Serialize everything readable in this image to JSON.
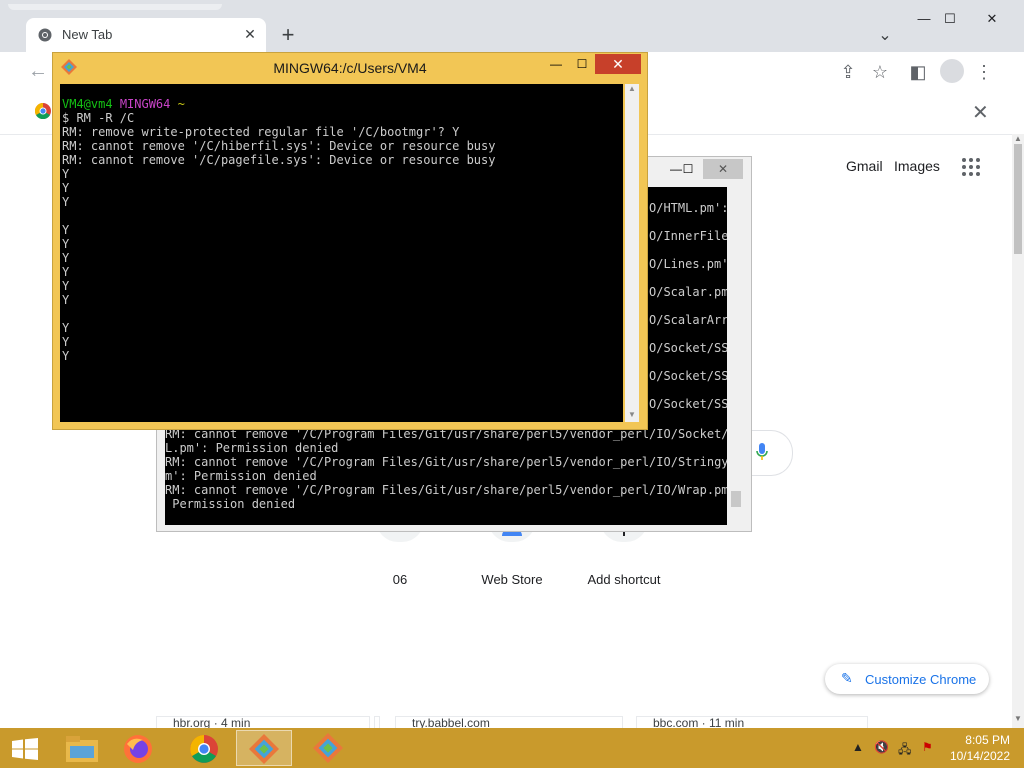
{
  "browser": {
    "tab_title": "New Tab",
    "tab_close": "✕",
    "new_tab": "+",
    "tab_search": "⌄",
    "minimize": "—",
    "maximize": "☐",
    "close": "✕",
    "back": "←",
    "share": "⇪",
    "star": "☆",
    "side_panel": "◧",
    "menu": "⋮",
    "promo_close": "✕"
  },
  "newtab": {
    "gmail": "Gmail",
    "images": "Images",
    "shortcuts": [
      {
        "label": "06"
      },
      {
        "label": "Web Store"
      },
      {
        "label": "Add shortcut"
      }
    ],
    "customize": "Customize Chrome",
    "customize_icon": "✎",
    "feed": [
      {
        "text": "hbr.org · 4 min"
      },
      {
        "text": "try.babbel.com"
      },
      {
        "text": "bbc.com · 11 min"
      }
    ]
  },
  "terminal_front": {
    "title": "MINGW64:/c/Users/VM4",
    "minimize": "—",
    "maximize": "☐",
    "close": "✕",
    "prompt_user": "VM4@vm4",
    "prompt_env": "MINGW64",
    "prompt_path": "~",
    "command": "$ RM -R /C",
    "lines": [
      "RM: remove write-protected regular file '/C/bootmgr'? Y",
      "RM: cannot remove '/C/hiberfil.sys': Device or resource busy",
      "RM: cannot remove '/C/pagefile.sys': Device or resource busy",
      "Y",
      "Y",
      "Y",
      "",
      "Y",
      "Y",
      "Y",
      "Y",
      "Y",
      "Y",
      "",
      "Y",
      "Y",
      "Y"
    ]
  },
  "terminal_back": {
    "minimize": "—",
    "maximize": "☐",
    "close": "✕",
    "fragments": [
      "O/HTML.pm':",
      "O/InnerFile",
      "O/Lines.pm'",
      "O/Scalar.pm",
      "O/ScalarArr",
      "O/Socket/SS",
      "O/Socket/SS",
      "O/Socket/SS"
    ],
    "lines": [
      "RM: cannot remove '/C/Program Files/Git/usr/share/perl5/vendor_perl/IO/Socket/SS",
      "L.pm': Permission denied",
      "RM: cannot remove '/C/Program Files/Git/usr/share/perl5/vendor_perl/IO/Stringy.p",
      "m': Permission denied",
      "RM: cannot remove '/C/Program Files/Git/usr/share/perl5/vendor_perl/IO/Wrap.pm':",
      " Permission denied"
    ]
  },
  "taskbar": {
    "time": "8:05 PM",
    "date": "10/14/2022",
    "accent": "#c99a2c"
  }
}
